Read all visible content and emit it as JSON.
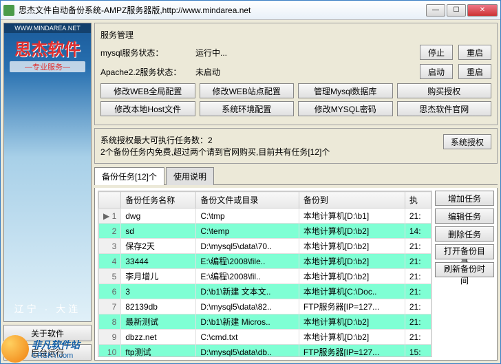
{
  "window": {
    "title": "思杰文件自动备份系统-AMPZ服务器版,http://www.mindarea.net"
  },
  "banner": {
    "url": "WWW.MINDAREA.NET",
    "logo": "思杰软件",
    "sub": "—专业服务—",
    "loc": "辽宁 · 大连"
  },
  "sidebar": {
    "about": "关于软件",
    "bg": "后台运行"
  },
  "service": {
    "title": "服务管理",
    "mysql_lbl": "mysql服务状态：",
    "mysql_val": "运行中...",
    "apache_lbl": "Apache2.2服务状态：",
    "apache_val": "未启动",
    "stop": "停止",
    "start": "启动",
    "restart": "重启",
    "row1": [
      "修改WEB全局配置",
      "修改WEB站点配置",
      "管理Mysql数据库",
      "购买授权"
    ],
    "row2": [
      "修改本地Host文件",
      "系统环境配置",
      "修改MYSQL密码",
      "思杰软件官网"
    ]
  },
  "auth": {
    "line1": "系统授权最大可执行任务数：2",
    "line2": "2个备份任务内免费,超过两个请到官网购买,目前共有任务[12]个",
    "btn": "系统授权"
  },
  "tabs": {
    "t1": "备份任务[12]个",
    "t2": "使用说明"
  },
  "table": {
    "headers": [
      "",
      "备份任务名称",
      "备份文件或目录",
      "备份到",
      "执"
    ],
    "rows": [
      {
        "i": 1,
        "hl": false,
        "c": [
          "dwg",
          "C:\\tmp",
          "本地计算机[D:\\b1]",
          "21:"
        ]
      },
      {
        "i": 2,
        "hl": true,
        "c": [
          "sd",
          "C:\\temp",
          "本地计算机[D:\\b2]",
          "14:"
        ]
      },
      {
        "i": 3,
        "hl": false,
        "c": [
          "保存2天",
          "D:\\mysql5\\data\\70..",
          "本地计算机[D:\\b2]",
          "21:"
        ]
      },
      {
        "i": 4,
        "hl": true,
        "c": [
          "33444",
          "E:\\编程\\2008\\file..",
          "本地计算机[D:\\b2]",
          "21:"
        ]
      },
      {
        "i": 5,
        "hl": false,
        "c": [
          "李月增儿",
          "E:\\编程\\2008\\fil..",
          "本地计算机[D:\\b2]",
          "21:"
        ]
      },
      {
        "i": 6,
        "hl": true,
        "c": [
          "3",
          "D:\\b1\\新建 文本文..",
          "本地计算机[C:\\Doc..",
          "21:"
        ]
      },
      {
        "i": 7,
        "hl": false,
        "c": [
          "82139db",
          "D:\\mysql5\\data\\82..",
          "FTP服务器[IP=127...",
          "21:"
        ]
      },
      {
        "i": 8,
        "hl": true,
        "c": [
          "最新测试",
          "D:\\b1\\新建 Micros..",
          "本地计算机[D:\\b2]",
          "21:"
        ]
      },
      {
        "i": 9,
        "hl": false,
        "c": [
          "dbzz.net",
          "C:\\cmd.txt",
          "本地计算机[D:\\b2]",
          "21:"
        ]
      },
      {
        "i": 10,
        "hl": true,
        "c": [
          "ftp测试",
          "D:\\mysql5\\data\\db..",
          "FTP服务器[IP=127...",
          "15:"
        ]
      }
    ]
  },
  "actions": {
    "add": "增加任务",
    "edit": "编辑任务",
    "del": "删除任务",
    "open": "打开备份目录",
    "refresh": "刷新备份时间"
  },
  "watermark": {
    "name": "非凡软件站",
    "url": "CRSKY.com"
  }
}
